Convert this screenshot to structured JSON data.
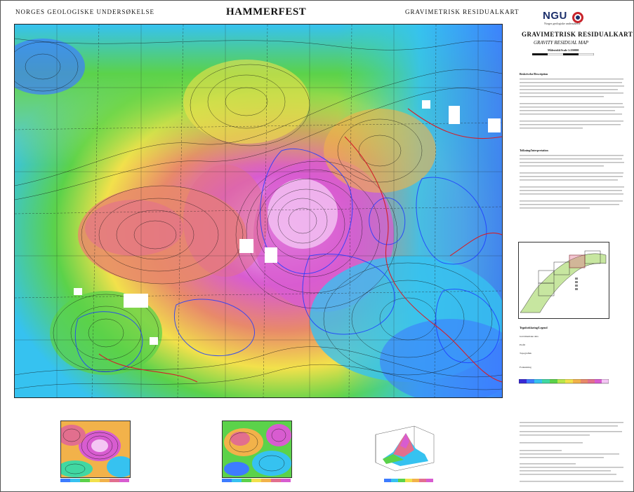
{
  "header": {
    "left": "NORGES GEOLOGISKE UNDERSØKELSE",
    "center": "HAMMERFEST",
    "right": "GRAVIMETRISK RESIDUALKART"
  },
  "logo": {
    "text": "NGU",
    "subtitle": "Norges geologiske undersøkelse"
  },
  "panel": {
    "title": "GRAVIMETRISK RESIDUALKART",
    "subtitle": "GRAVITY RESIDUAL MAP",
    "scale": "Målestokk/Scale 1:250000",
    "sections": [
      {
        "heading": "Beskrivelse/Description",
        "text": ""
      },
      {
        "heading": "Tolkning/Interpretation",
        "text": ""
      },
      {
        "heading": "Tegnforklaring/Legend",
        "text": ""
      }
    ],
    "legend": [
      {
        "label": "Gravimetriske data"
      },
      {
        "label": "Profil"
      },
      {
        "label": "Topografisk"
      },
      {
        "label": "Forkastning"
      }
    ]
  },
  "colors": {
    "map_palette": [
      "#3a2ad6",
      "#3d7cff",
      "#36c2f0",
      "#41d8a2",
      "#5bd24a",
      "#b9e64a",
      "#f2e14b",
      "#f2b24a",
      "#e8896a",
      "#e26f8e",
      "#d85cd0",
      "#f4c6f4"
    ],
    "contour": "#111111",
    "geology_blue": "#1e3cff",
    "fault_red": "#d2202a",
    "border": "#222222"
  },
  "icons": [
    "ngu-logo-icon",
    "north-arrow-icon"
  ]
}
